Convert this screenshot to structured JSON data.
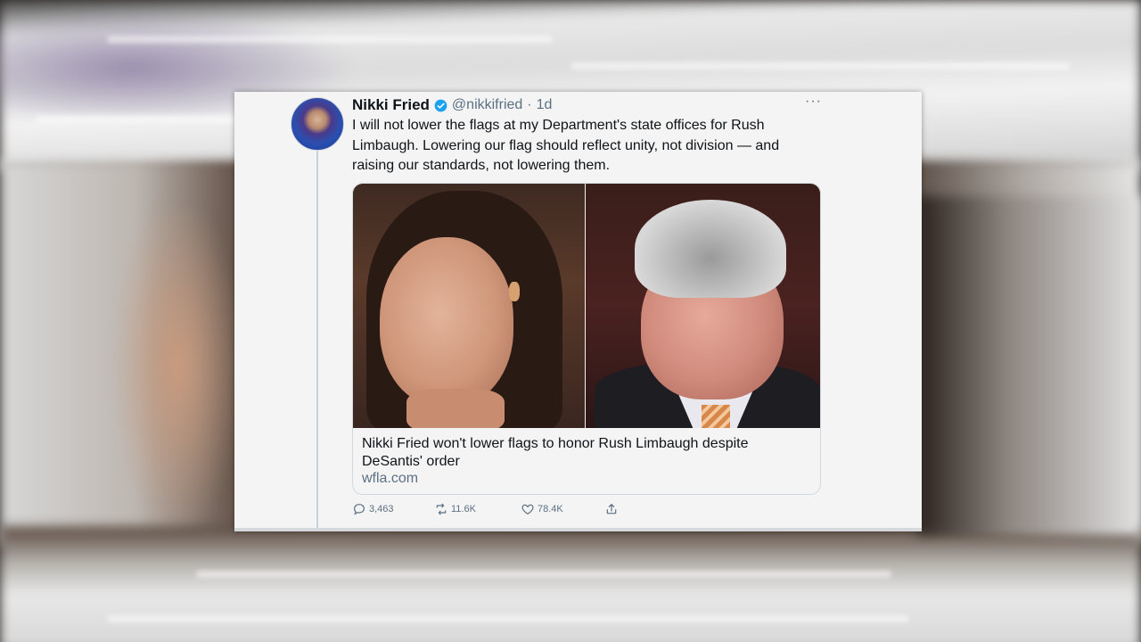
{
  "tweet": {
    "author_name": "Nikki Fried",
    "handle": "@nikkifried",
    "separator": "·",
    "time": "1d",
    "more_label": "···",
    "text": "I will not lower the flags at my Department's state offices for Rush Limbaugh. Lowering our flag should reflect unity, not division — and raising our standards, not lowering them.",
    "link_card": {
      "title": "Nikki Fried won't lower flags to honor Rush Limbaugh despite DeSantis' order",
      "domain": "wfla.com"
    },
    "actions": {
      "replies": "3,463",
      "retweets": "11.6K",
      "likes": "78.4K"
    }
  },
  "icons": [
    "verified-badge-icon",
    "more-icon",
    "reply-icon",
    "retweet-icon",
    "like-icon",
    "share-icon"
  ],
  "colors": {
    "verified": "#1da1f2",
    "text_primary": "#0f1419",
    "text_secondary": "#5b7083"
  }
}
